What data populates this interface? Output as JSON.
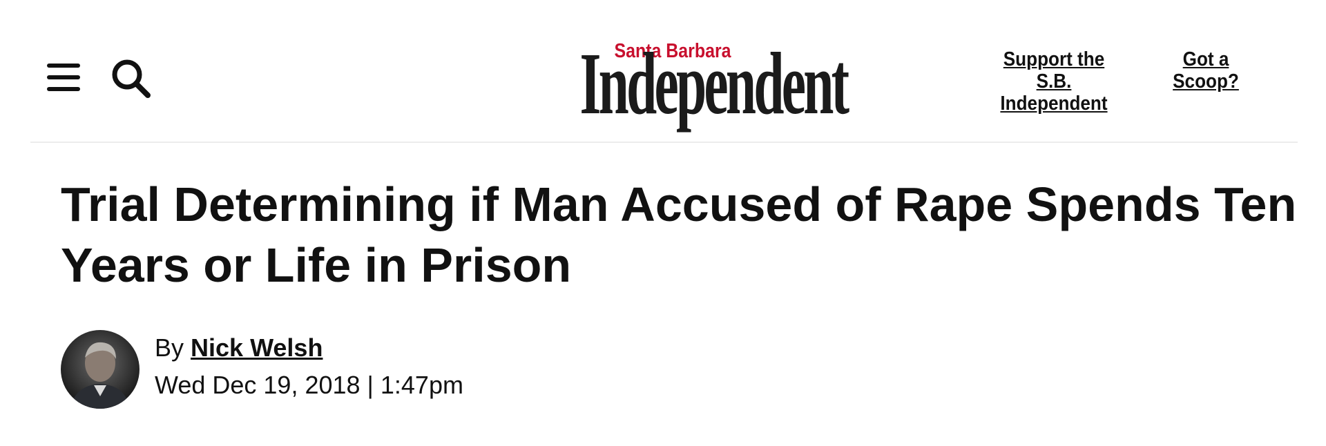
{
  "header": {
    "logo_top": "Santa Barbara",
    "logo_main": "Independent",
    "support_label": "Support the S.B. Independent",
    "scoop_label": "Got a Scoop?"
  },
  "article": {
    "title": "Trial Determining if Man Accused of Rape Spends Ten Years or Life in Prison",
    "by_label": "By",
    "author": "Nick Welsh",
    "date": "Wed Dec 19, 2018 | 1:47pm"
  },
  "icons": {
    "menu": "hamburger-menu-icon",
    "search": "search-icon"
  },
  "colors": {
    "brand_red": "#c8102e",
    "text": "#111111"
  }
}
